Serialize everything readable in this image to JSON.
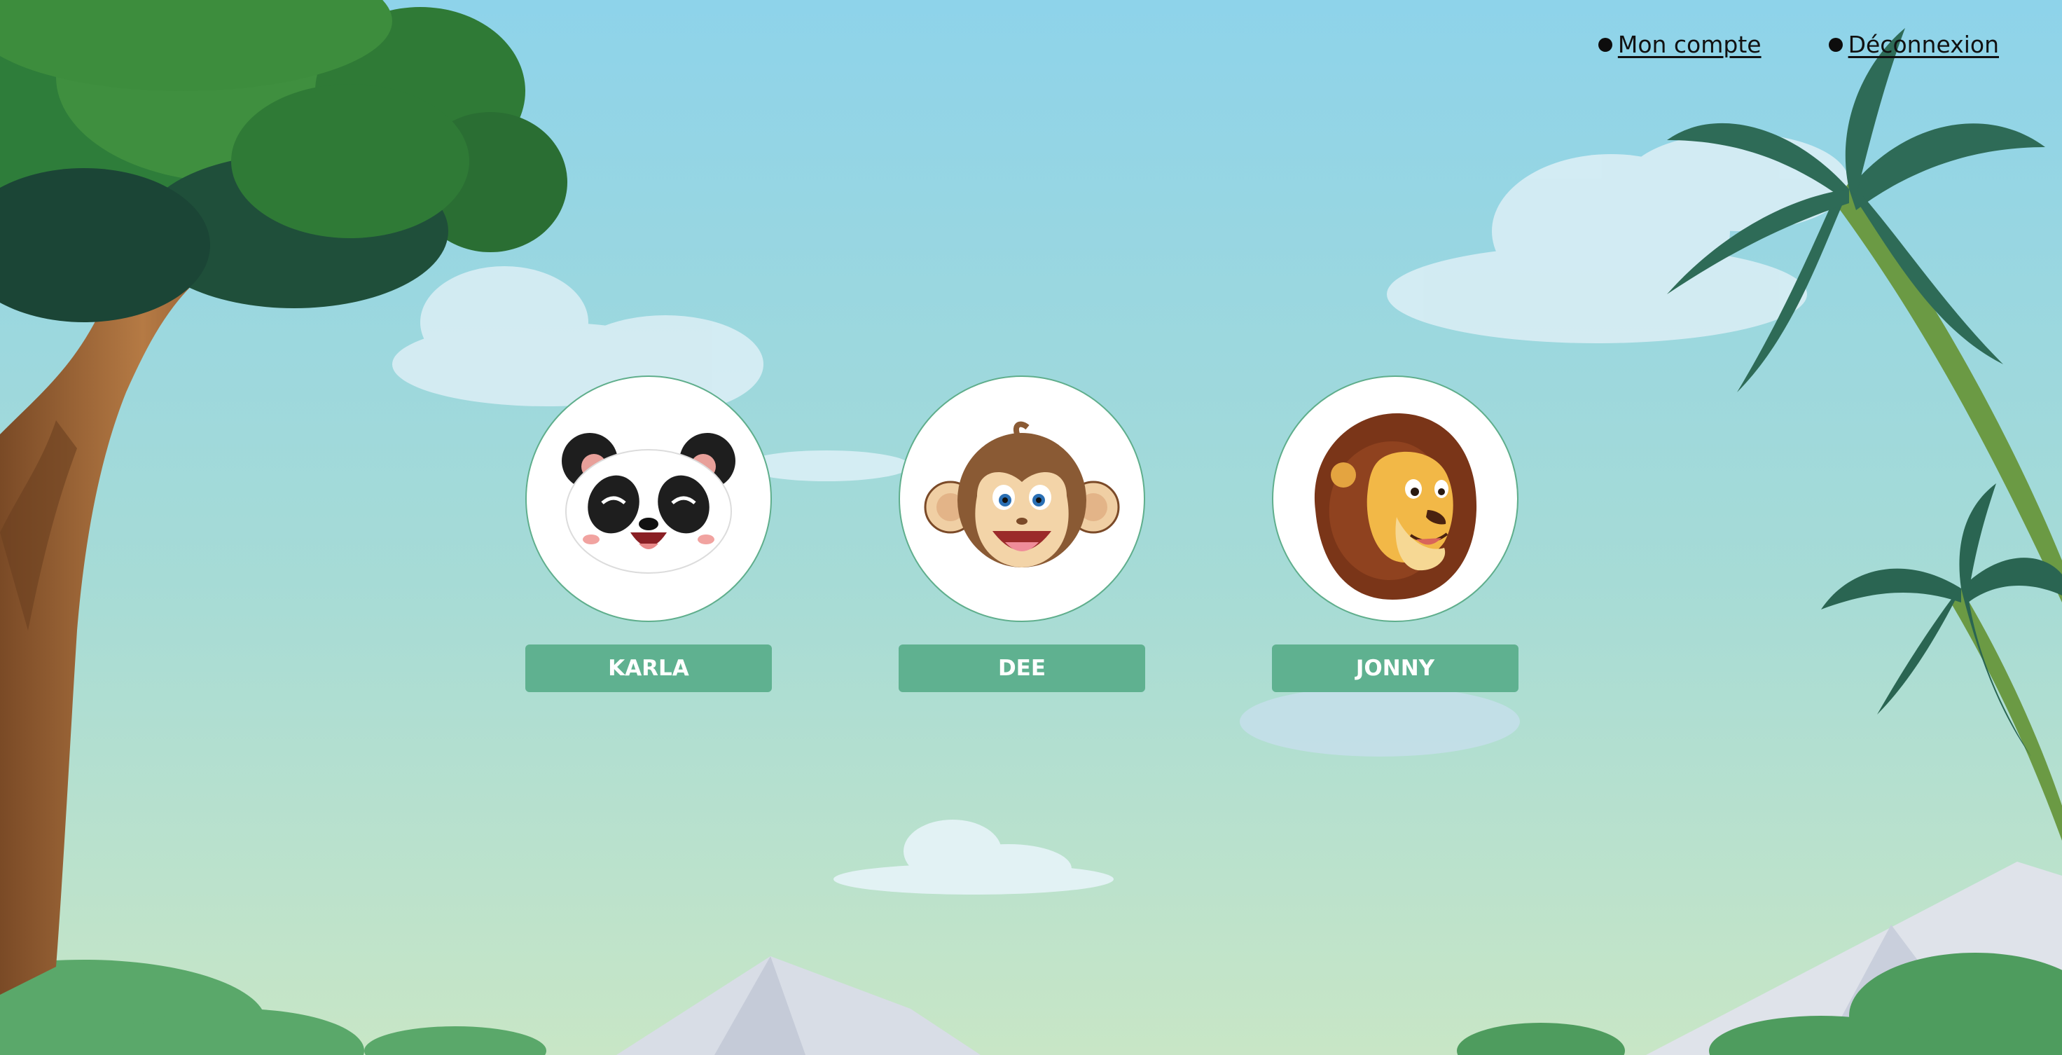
{
  "nav": {
    "account_label": "Mon compte",
    "logout_label": "Déconnexion"
  },
  "profiles": [
    {
      "name": "KARLA",
      "avatar": "panda-icon"
    },
    {
      "name": "DEE",
      "avatar": "monkey-icon"
    },
    {
      "name": "JONNY",
      "avatar": "lion-icon"
    }
  ],
  "colors": {
    "button": "#5fb190",
    "sky_top": "#8ed3ea",
    "sky_bottom": "#c4e4c8"
  }
}
